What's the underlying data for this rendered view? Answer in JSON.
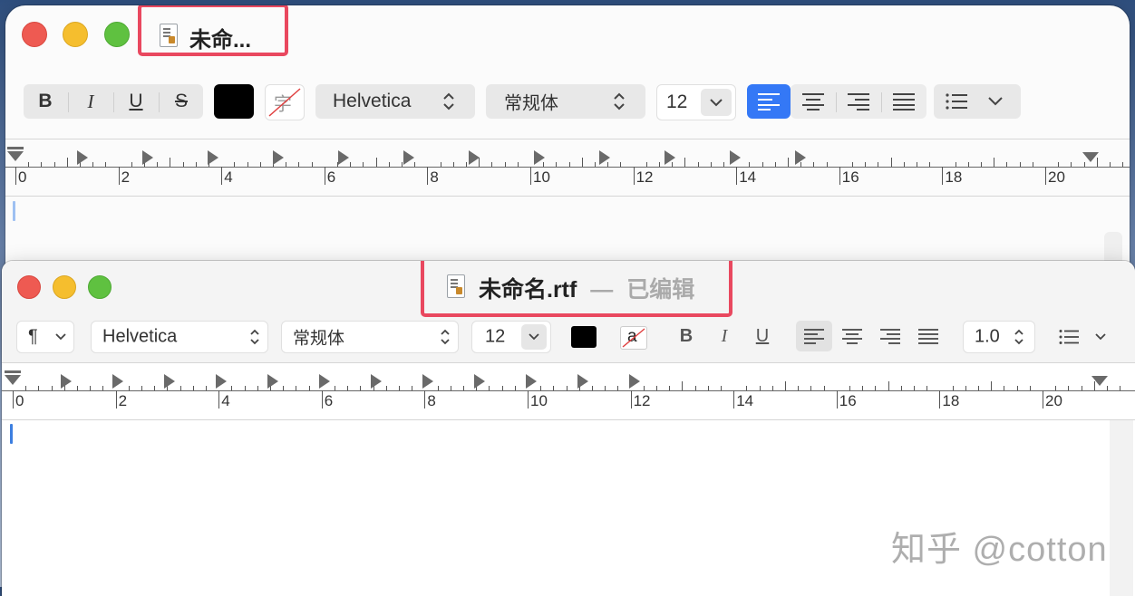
{
  "window_back": {
    "title": "未命...",
    "toolbar": {
      "bold": "B",
      "italic": "I",
      "underline": "U",
      "strike": "S",
      "bg_color_glyph": "字",
      "font_family": "Helvetica",
      "font_style": "常规体",
      "font_size": "12",
      "text_color": "#000000"
    },
    "ruler": [
      "0",
      "2",
      "4",
      "6",
      "8",
      "10",
      "12",
      "14",
      "16",
      "18",
      "20"
    ]
  },
  "window_front": {
    "title": "未命名.rtf",
    "title_separator": "—",
    "title_status": "已编辑",
    "toolbar": {
      "paragraph_glyph": "¶",
      "font_family": "Helvetica",
      "font_style": "常规体",
      "font_size": "12",
      "bg_color_glyph": "a",
      "bold": "B",
      "italic": "I",
      "underline": "U",
      "line_spacing": "1.0",
      "text_color": "#000000"
    },
    "ruler": [
      "0",
      "2",
      "4",
      "6",
      "8",
      "10",
      "12",
      "14",
      "16",
      "18",
      "20"
    ]
  },
  "colors": {
    "accent": "#3478f6",
    "highlight": "#e9485f"
  },
  "watermark": "知乎 @cotton"
}
